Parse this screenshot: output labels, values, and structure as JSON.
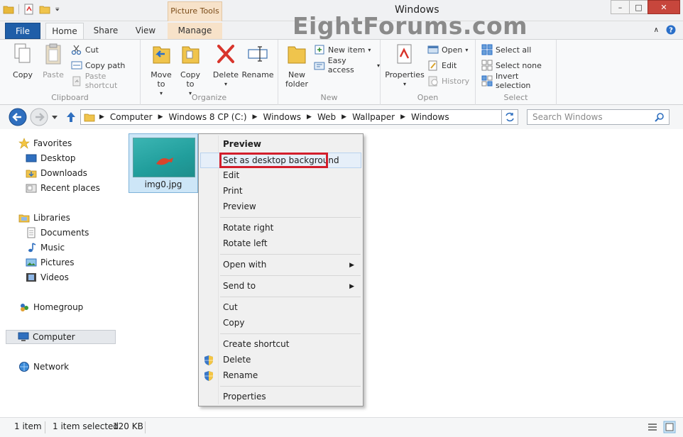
{
  "window": {
    "title": "Windows",
    "context_tab_group": "Picture Tools",
    "watermark": "EightForums.com"
  },
  "tabs": {
    "file": "File",
    "home": "Home",
    "share": "Share",
    "view": "View",
    "manage": "Manage"
  },
  "ribbon": {
    "clipboard": {
      "label": "Clipboard",
      "copy": "Copy",
      "paste": "Paste",
      "cut": "Cut",
      "copy_path": "Copy path",
      "paste_shortcut": "Paste shortcut"
    },
    "organize": {
      "label": "Organize",
      "move_to": "Move to",
      "copy_to": "Copy to",
      "delete": "Delete",
      "rename": "Rename"
    },
    "new": {
      "label": "New",
      "new_folder_line1": "New",
      "new_folder_line2": "folder",
      "new_item": "New item",
      "easy_access": "Easy access"
    },
    "open": {
      "label": "Open",
      "properties": "Properties",
      "open": "Open",
      "edit": "Edit",
      "history": "History"
    },
    "select": {
      "label": "Select",
      "select_all": "Select all",
      "select_none": "Select none",
      "invert_selection": "Invert selection"
    }
  },
  "address": {
    "crumbs": [
      "Computer",
      "Windows 8 CP (C:)",
      "Windows",
      "Web",
      "Wallpaper",
      "Windows"
    ],
    "search_placeholder": "Search Windows"
  },
  "navpane": {
    "favorites": "Favorites",
    "desktop": "Desktop",
    "downloads": "Downloads",
    "recent_places": "Recent places",
    "libraries": "Libraries",
    "documents": "Documents",
    "music": "Music",
    "pictures": "Pictures",
    "videos": "Videos",
    "homegroup": "Homegroup",
    "computer": "Computer",
    "network": "Network"
  },
  "content": {
    "file_name": "img0.jpg"
  },
  "context_menu": {
    "preview_bold": "Preview",
    "set_desktop_bg": "Set as desktop background",
    "edit": "Edit",
    "print": "Print",
    "preview": "Preview",
    "rotate_right": "Rotate right",
    "rotate_left": "Rotate left",
    "open_with": "Open with",
    "send_to": "Send to",
    "cut": "Cut",
    "copy": "Copy",
    "create_shortcut": "Create shortcut",
    "delete": "Delete",
    "rename": "Rename",
    "properties": "Properties"
  },
  "statusbar": {
    "item_count": "1 item",
    "selected": "1 item selected",
    "size": "120 KB"
  },
  "colors": {
    "accent": "#1f5ea8",
    "highlight": "#d21e2c",
    "selection": "#cde6f7"
  }
}
